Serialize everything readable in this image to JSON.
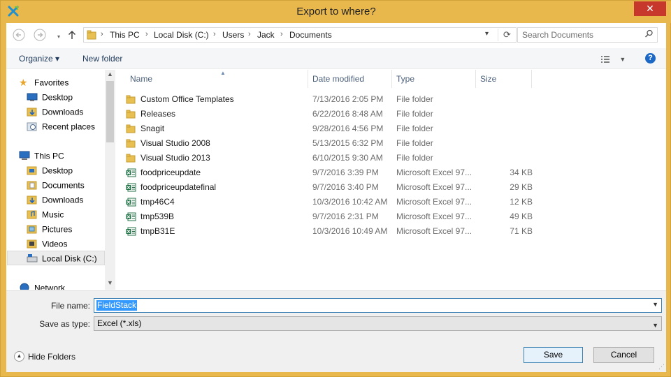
{
  "window": {
    "title": "Export to where?",
    "close_glyph": "✕"
  },
  "address": {
    "crumbs": [
      "This PC",
      "Local Disk (C:)",
      "Users",
      "Jack",
      "Documents"
    ],
    "search_placeholder": "Search Documents"
  },
  "toolbar": {
    "organize_label": "Organize ▾",
    "new_folder_label": "New folder"
  },
  "nav": {
    "favorites_label": "Favorites",
    "favorites": [
      "Desktop",
      "Downloads",
      "Recent places"
    ],
    "thispc_label": "This PC",
    "thispc": [
      "Desktop",
      "Documents",
      "Downloads",
      "Music",
      "Pictures",
      "Videos",
      "Local Disk (C:)"
    ],
    "network_label": "Network"
  },
  "columns": {
    "name": "Name",
    "date": "Date modified",
    "type": "Type",
    "size": "Size"
  },
  "files": [
    {
      "name": "Custom Office Templates",
      "date": "7/13/2016 2:05 PM",
      "type": "File folder",
      "size": "",
      "icon": "folder-icon"
    },
    {
      "name": "Releases",
      "date": "6/22/2016 8:48 AM",
      "type": "File folder",
      "size": "",
      "icon": "folder-icon"
    },
    {
      "name": "Snagit",
      "date": "9/28/2016 4:56 PM",
      "type": "File folder",
      "size": "",
      "icon": "folder-icon"
    },
    {
      "name": "Visual Studio 2008",
      "date": "5/13/2015 6:32 PM",
      "type": "File folder",
      "size": "",
      "icon": "folder-icon"
    },
    {
      "name": "Visual Studio 2013",
      "date": "6/10/2015 9:30 AM",
      "type": "File folder",
      "size": "",
      "icon": "folder-icon"
    },
    {
      "name": "foodpriceupdate",
      "date": "9/7/2016 3:39 PM",
      "type": "Microsoft Excel 97...",
      "size": "34 KB",
      "icon": "excel-file-icon"
    },
    {
      "name": "foodpriceupdatefinal",
      "date": "9/7/2016 3:40 PM",
      "type": "Microsoft Excel 97...",
      "size": "29 KB",
      "icon": "excel-file-icon"
    },
    {
      "name": "tmp46C4",
      "date": "10/3/2016 10:42 AM",
      "type": "Microsoft Excel 97...",
      "size": "12 KB",
      "icon": "excel-file-icon"
    },
    {
      "name": "tmp539B",
      "date": "9/7/2016 2:31 PM",
      "type": "Microsoft Excel 97...",
      "size": "49 KB",
      "icon": "excel-file-icon"
    },
    {
      "name": "tmpB31E",
      "date": "10/3/2016 10:49 AM",
      "type": "Microsoft Excel 97...",
      "size": "71 KB",
      "icon": "excel-file-icon"
    }
  ],
  "form": {
    "filename_label": "File name:",
    "filename_value": "FieldStack",
    "savetype_label": "Save as type:",
    "savetype_value": "Excel (*.xls)",
    "hide_folders_label": "Hide Folders",
    "save_label": "Save",
    "cancel_label": "Cancel"
  },
  "colors": {
    "title_bar": "#e8b84d",
    "close_button": "#c7372c",
    "selection": "#3399ff",
    "folder": "#e8c051",
    "excel": "#207245"
  }
}
